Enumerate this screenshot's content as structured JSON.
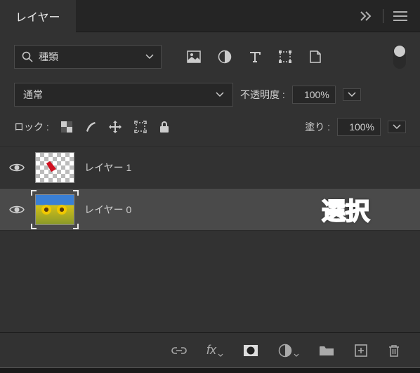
{
  "panel": {
    "title": "レイヤー",
    "collapse_icon": "»"
  },
  "filter": {
    "search_icon": "search",
    "label": "種類"
  },
  "blend": {
    "mode": "通常",
    "opacity_label": "不透明度 :",
    "opacity_value": "100%"
  },
  "lock": {
    "label": "ロック :",
    "fill_label": "塗り :",
    "fill_value": "100%"
  },
  "layers": [
    {
      "name": "レイヤー 1",
      "selected": false
    },
    {
      "name": "レイヤー 0",
      "selected": true
    }
  ],
  "annotation": "選択"
}
